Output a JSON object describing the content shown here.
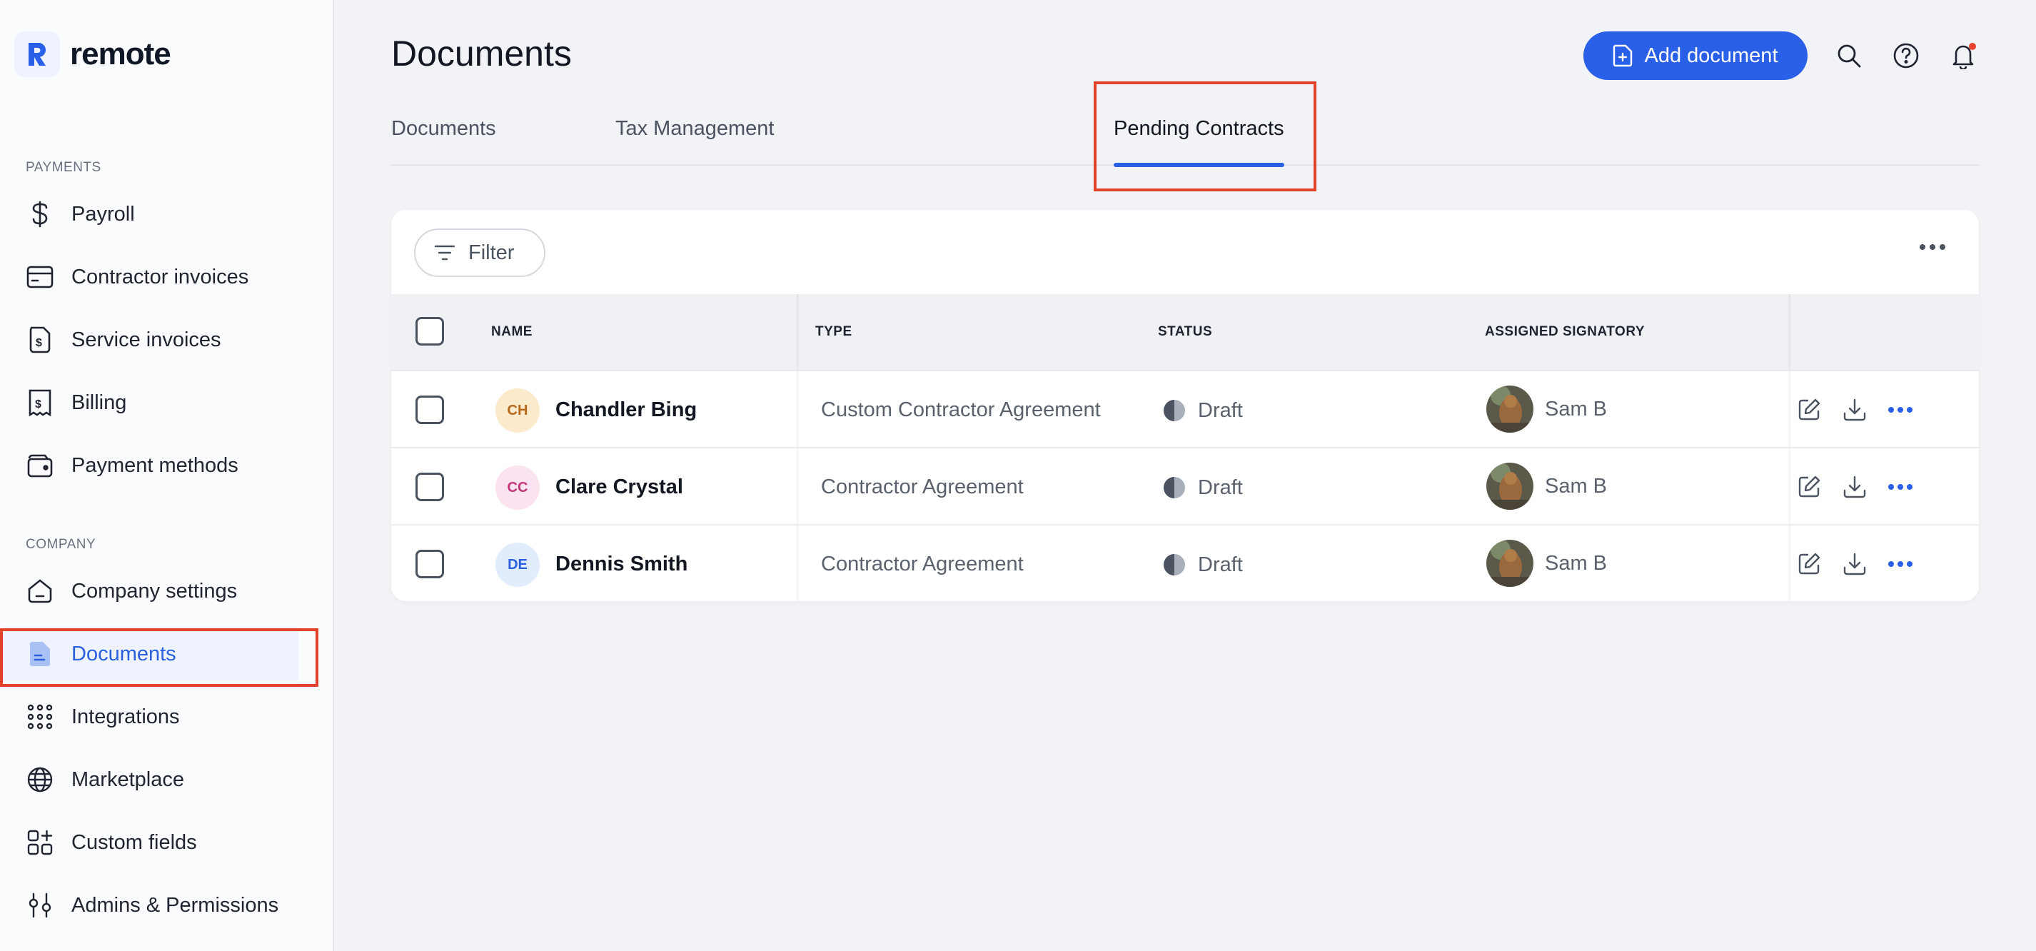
{
  "brand": {
    "name": "remote",
    "accent": "#2a5fe8"
  },
  "sidebar": {
    "sections": [
      {
        "label": "PAYMENTS"
      },
      {
        "label": "COMPANY"
      }
    ],
    "items": [
      {
        "label": "Payroll",
        "icon": "dollar-icon"
      },
      {
        "label": "Contractor invoices",
        "icon": "card-icon"
      },
      {
        "label": "Service invoices",
        "icon": "invoice-icon"
      },
      {
        "label": "Billing",
        "icon": "bill-icon"
      },
      {
        "label": "Payment methods",
        "icon": "wallet-icon"
      },
      {
        "label": "Company settings",
        "icon": "home-icon"
      },
      {
        "label": "Documents",
        "icon": "document-icon",
        "active": true
      },
      {
        "label": "Integrations",
        "icon": "grid-dots-icon"
      },
      {
        "label": "Marketplace",
        "icon": "globe-icon"
      },
      {
        "label": "Custom fields",
        "icon": "custom-fields-icon"
      },
      {
        "label": "Admins & Permissions",
        "icon": "sliders-icon"
      }
    ]
  },
  "header": {
    "title": "Documents",
    "add_button": "Add document"
  },
  "tabs": [
    {
      "label": "Documents"
    },
    {
      "label": "Tax Management"
    },
    {
      "label": "Pending Contracts",
      "active": true
    }
  ],
  "table": {
    "filter_label": "Filter",
    "columns": [
      "NAME",
      "TYPE",
      "STATUS",
      "ASSIGNED SIGNATORY"
    ],
    "rows": [
      {
        "initials": "CH",
        "name": "Chandler Bing",
        "type": "Custom Contractor Agreement",
        "status": "Draft",
        "signatory": "Sam B",
        "avatar_bg": "#fbeacb",
        "avatar_fg": "#b5691d"
      },
      {
        "initials": "CC",
        "name": "Clare Crystal",
        "type": "Contractor Agreement",
        "status": "Draft",
        "signatory": "Sam B",
        "avatar_bg": "#fbe3ef",
        "avatar_fg": "#c2367a"
      },
      {
        "initials": "DE",
        "name": "Dennis Smith",
        "type": "Contractor Agreement",
        "status": "Draft",
        "signatory": "Sam B",
        "avatar_bg": "#e1ecfd",
        "avatar_fg": "#2a5fde"
      }
    ]
  }
}
